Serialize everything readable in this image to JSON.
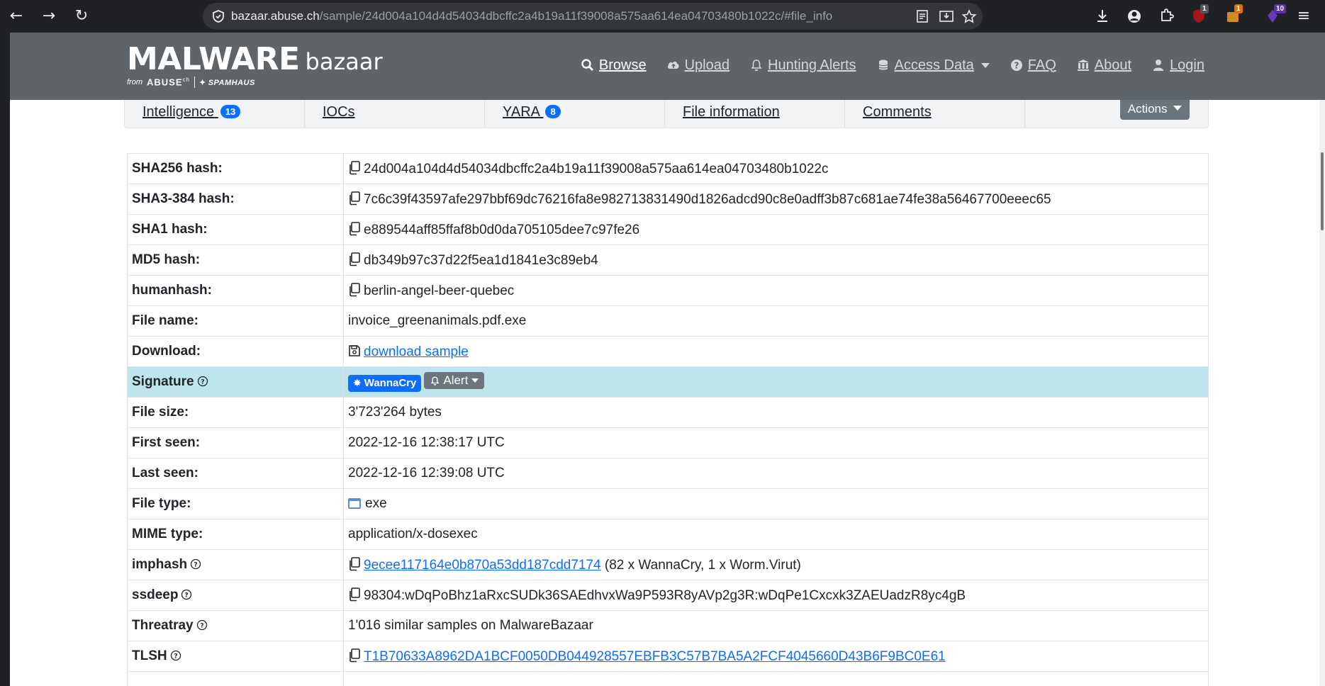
{
  "browser": {
    "url_host": "bazaar.abuse.ch",
    "url_path": "/sample/24d004a104d4d54034dbcffc2a4b19a11f39008a575aa614ea04703480b1022c/#file_info",
    "ext_badges": [
      "1",
      "1",
      "10"
    ]
  },
  "brand": {
    "main": "MALWARE",
    "sub": "bazaar",
    "from": "from",
    "abuse": "ABUSE",
    "abuse_sup": "ch",
    "spamhaus": "SPAMHAUS"
  },
  "nav": {
    "browse": "Browse",
    "upload": "Upload",
    "hunting": "Hunting Alerts",
    "access": "Access Data",
    "faq": "FAQ",
    "about": "About",
    "login": "Login"
  },
  "tabs": {
    "intelligence": "Intelligence",
    "intelligence_count": "13",
    "iocs": "IOCs",
    "yara": "YARA",
    "yara_count": "8",
    "file_info": "File information",
    "comments": "Comments",
    "actions": "Actions"
  },
  "info": {
    "sha256_label": "SHA256 hash:",
    "sha256": "24d004a104d4d54034dbcffc2a4b19a11f39008a575aa614ea04703480b1022c",
    "sha3_label": "SHA3-384 hash:",
    "sha3": "7c6c39f43597afe297bbf69dc76216fa8e982713831490d1826adcd90c8e0adff3b87c681ae74fe38a56467700eeec65",
    "sha1_label": "SHA1 hash:",
    "sha1": "e889544aff85ffaf8b0d0da705105dee7c97fe26",
    "md5_label": "MD5 hash:",
    "md5": "db349b97c37d22f5ea1d1841e3c89eb4",
    "humanhash_label": "humanhash:",
    "humanhash": "berlin-angel-beer-quebec",
    "filename_label": "File name:",
    "filename": "invoice_greenanimals.pdf.exe",
    "download_label": "Download:",
    "download": "download sample",
    "signature_label": "Signature",
    "signature": "WannaCry",
    "alert": "Alert",
    "filesize_label": "File size:",
    "filesize": "3'723'264 bytes",
    "firstseen_label": "First seen:",
    "firstseen": "2022-12-16 12:38:17 UTC",
    "lastseen_label": "Last seen:",
    "lastseen": "2022-12-16 12:39:08 UTC",
    "filetype_label": "File type:",
    "filetype": "exe",
    "mime_label": "MIME type:",
    "mime": "application/x-dosexec",
    "imphash_label": "imphash",
    "imphash": "9ecee117164e0b870a53dd187cdd7174",
    "imphash_note": "(82 x WannaCry, 1 x Worm.Virut)",
    "ssdeep_label": "ssdeep",
    "ssdeep": "98304:wDqPoBhz1aRxcSUDk36SAEdhvxWa9P593R8yAVp2g3R:wDqPe1Cxcxk3ZAEUadzR8yc4gB",
    "threatray_label": "Threatray",
    "threatray": "1'016 similar samples on MalwareBazaar",
    "tlsh_label": "TLSH",
    "tlsh": "T1B70633A8962DA1BCF0050DB044928557EBFB3C57B7BA5A2FCF4045660D43B6F9BC0E61"
  }
}
